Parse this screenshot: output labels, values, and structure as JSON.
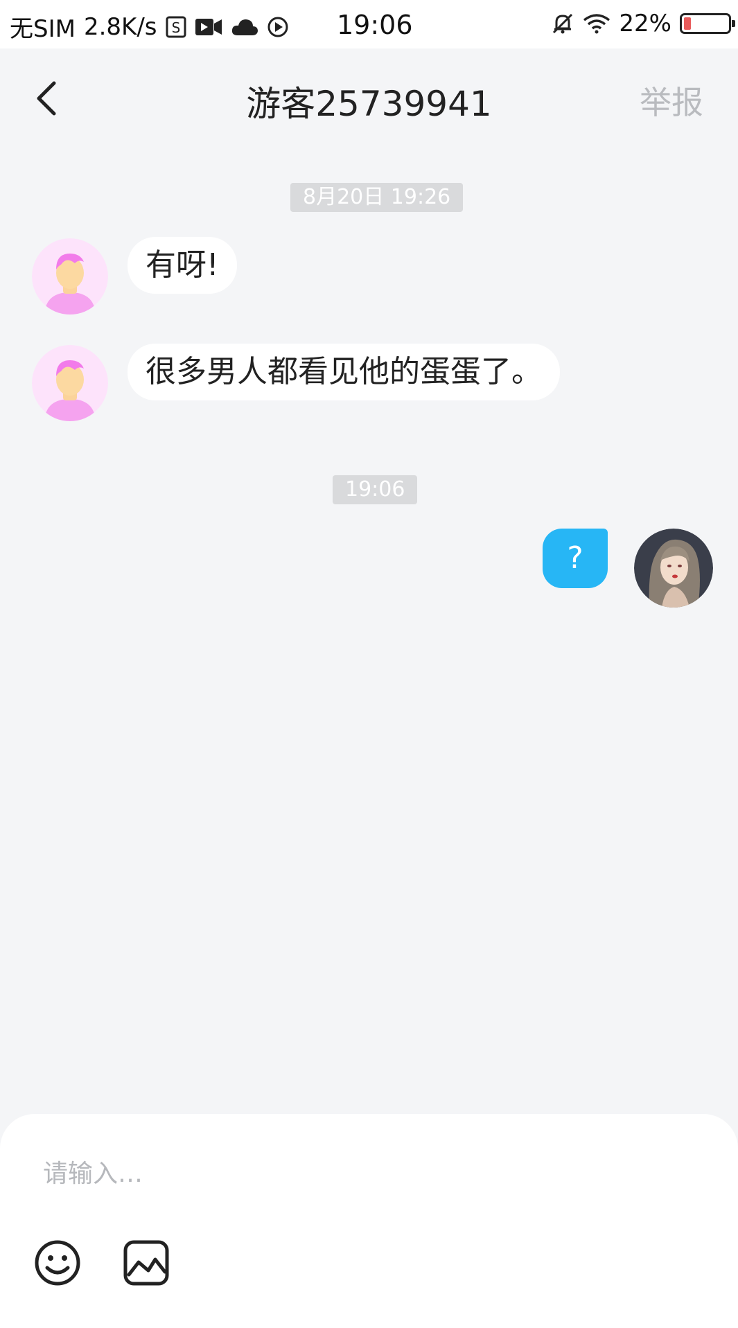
{
  "status_bar": {
    "sim": "无SIM",
    "speed": "2.8K/s",
    "time": "19:06",
    "battery": "22%"
  },
  "header": {
    "title": "游客25739941",
    "report_label": "举报"
  },
  "messages": {
    "timestamp1": "8月20日 19:26",
    "msg1": "有呀!",
    "msg2": "很多男人都看见他的蛋蛋了。",
    "timestamp2": "19:06",
    "msg3": "?"
  },
  "input": {
    "placeholder": "请输入…"
  },
  "colors": {
    "bubble_mine": "#27b6f5",
    "background": "#f4f5f7",
    "report_text": "#b9bbbf"
  },
  "icons": [
    "chevron-left-icon",
    "emoji-icon",
    "image-icon"
  ]
}
